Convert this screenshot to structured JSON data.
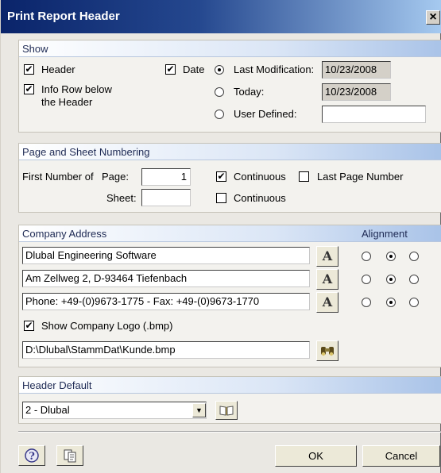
{
  "window": {
    "title": "Print Report Header",
    "close_glyph": "×"
  },
  "show": {
    "heading": "Show",
    "header_label": "Header",
    "info_row_label_1": "Info Row below",
    "info_row_label_2": "the Header",
    "date_label": "Date",
    "last_modification_label": "Last Modification:",
    "last_modification_value": "10/23/2008",
    "today_label": "Today:",
    "today_value": "10/23/2008",
    "user_defined_label": "User Defined:",
    "user_defined_value": ""
  },
  "numbering": {
    "heading": "Page and Sheet Numbering",
    "first_number_label": "First Number of",
    "page_label": "Page:",
    "page_value": "1",
    "sheet_label": "Sheet:",
    "sheet_value": "",
    "continuous_page_label": "Continuous",
    "last_page_number_label": "Last Page Number",
    "continuous_sheet_label": "Continuous"
  },
  "company": {
    "heading": "Company Address",
    "alignment_label": "Alignment",
    "line1": "Dlubal Engineering Software",
    "line2": "Am Zellweg 2, D-93464 Tiefenbach",
    "line3": "Phone: +49-(0)9673-1775 - Fax: +49-(0)9673-1770",
    "show_logo_label": "Show Company Logo (.bmp)",
    "logo_path": "D:\\Dlubal\\StammDat\\Kunde.bmp",
    "font_icon_glyph": "A"
  },
  "header_default": {
    "heading": "Header Default",
    "selected": "2 - Dlubal"
  },
  "footer": {
    "ok_label": "OK",
    "cancel_label": "Cancel"
  },
  "colors": {
    "title_bar": "#0a246a",
    "group_header": "#a9c3e8",
    "dialog_bg": "#eae8e3"
  }
}
